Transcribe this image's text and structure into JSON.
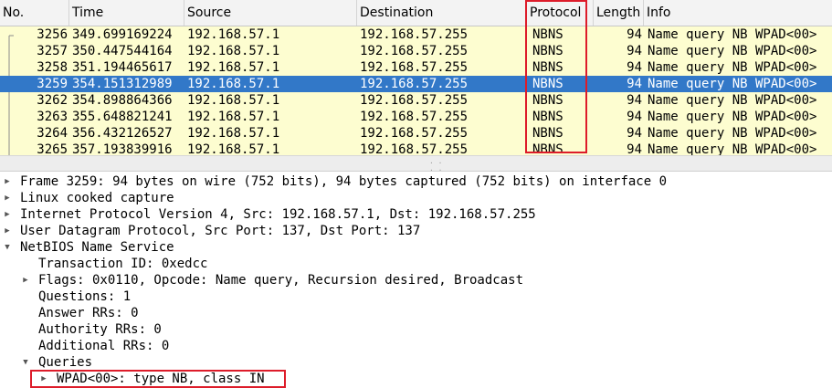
{
  "columns": {
    "no": "No.",
    "time": "Time",
    "source": "Source",
    "destination": "Destination",
    "protocol": "Protocol",
    "length": "Length",
    "info": "Info"
  },
  "packets": [
    {
      "no": "3256",
      "time": "349.699169224",
      "source": "192.168.57.1",
      "destination": "192.168.57.255",
      "protocol": "NBNS",
      "length": "94",
      "info": "Name query NB WPAD<00>"
    },
    {
      "no": "3257",
      "time": "350.447544164",
      "source": "192.168.57.1",
      "destination": "192.168.57.255",
      "protocol": "NBNS",
      "length": "94",
      "info": "Name query NB WPAD<00>"
    },
    {
      "no": "3258",
      "time": "351.194465617",
      "source": "192.168.57.1",
      "destination": "192.168.57.255",
      "protocol": "NBNS",
      "length": "94",
      "info": "Name query NB WPAD<00>"
    },
    {
      "no": "3259",
      "time": "354.151312989",
      "source": "192.168.57.1",
      "destination": "192.168.57.255",
      "protocol": "NBNS",
      "length": "94",
      "info": "Name query NB WPAD<00>"
    },
    {
      "no": "3262",
      "time": "354.898864366",
      "source": "192.168.57.1",
      "destination": "192.168.57.255",
      "protocol": "NBNS",
      "length": "94",
      "info": "Name query NB WPAD<00>"
    },
    {
      "no": "3263",
      "time": "355.648821241",
      "source": "192.168.57.1",
      "destination": "192.168.57.255",
      "protocol": "NBNS",
      "length": "94",
      "info": "Name query NB WPAD<00>"
    },
    {
      "no": "3264",
      "time": "356.432126527",
      "source": "192.168.57.1",
      "destination": "192.168.57.255",
      "protocol": "NBNS",
      "length": "94",
      "info": "Name query NB WPAD<00>"
    },
    {
      "no": "3265",
      "time": "357.193839916",
      "source": "192.168.57.1",
      "destination": "192.168.57.255",
      "protocol": "NBNS",
      "length": "94",
      "info": "Name query NB WPAD<00>"
    }
  ],
  "details": {
    "frame": "Frame 3259: 94 bytes on wire (752 bits), 94 bytes captured (752 bits) on interface 0",
    "linux_cooked": "Linux cooked capture",
    "ipv4": "Internet Protocol Version 4, Src: 192.168.57.1, Dst: 192.168.57.255",
    "udp": "User Datagram Protocol, Src Port: 137, Dst Port: 137",
    "nbns": "NetBIOS Name Service",
    "transaction_id": "Transaction ID: 0xedcc",
    "flags": "Flags: 0x0110, Opcode: Name query, Recursion desired, Broadcast",
    "questions": "Questions: 1",
    "answer_rrs": "Answer RRs: 0",
    "authority_rrs": "Authority RRs: 0",
    "additional_rrs": "Additional RRs: 0",
    "queries": "Queries",
    "wpad": "WPAD<00>: type NB, class IN"
  },
  "colors": {
    "list_bg": "#fdfdd0",
    "selected_bg": "#3278c8",
    "highlight_box": "#dd1c2a"
  },
  "icons": {
    "collapsed": "triangle-right-icon",
    "expanded": "triangle-down-icon"
  }
}
